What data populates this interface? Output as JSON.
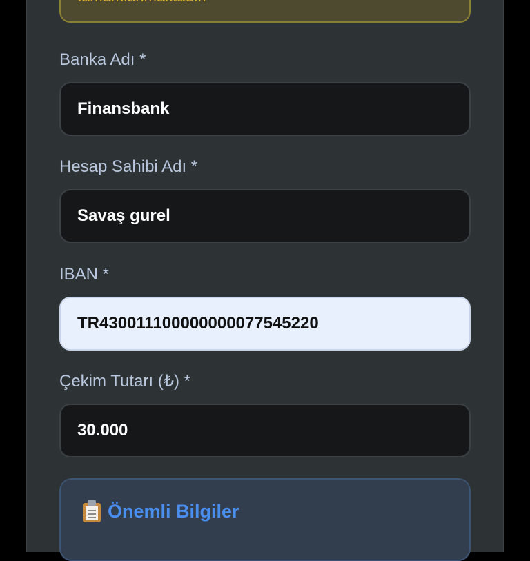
{
  "notice": {
    "text": "tamamlanmaktadır."
  },
  "form": {
    "bank_name": {
      "label": "Banka Adı *",
      "value": "Finansbank"
    },
    "account_holder": {
      "label": "Hesap Sahibi Adı *",
      "value": "Savaş gurel"
    },
    "iban": {
      "label": "IBAN *",
      "value": "TR430011100000000077545220"
    },
    "amount": {
      "label": "Çekim Tutarı (₺) *",
      "value": "30.000"
    }
  },
  "info": {
    "title": "Önemli Bilgiler",
    "icon": "clipboard-icon"
  }
}
